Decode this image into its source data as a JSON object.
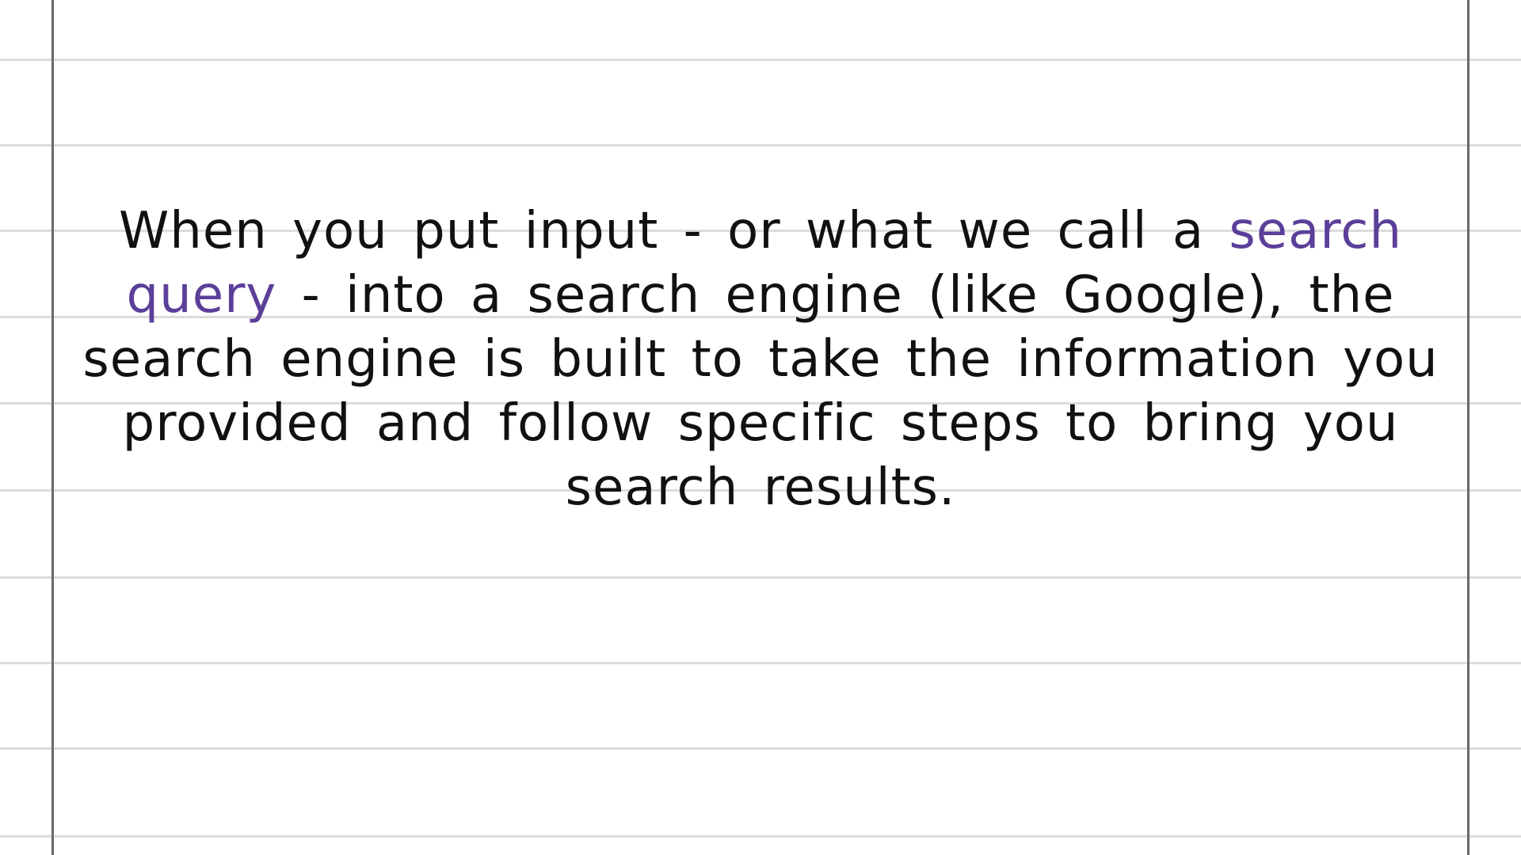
{
  "paragraph": {
    "part1": "When you put input - or what we call a ",
    "highlight": "search query",
    "part2": " - into a search engine (like Google), the search engine is built to take the information you provided and follow specific steps to bring you search results."
  },
  "colors": {
    "background": "#ffffff",
    "text": "#111111",
    "highlight": "#5b3f99",
    "rule_line": "#dcdcdc",
    "margin_line": "#6a6a6a"
  }
}
